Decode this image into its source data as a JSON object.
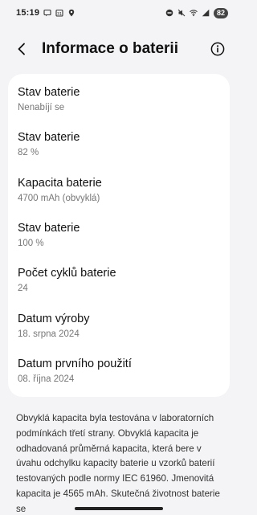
{
  "status_bar": {
    "time": "15:19",
    "battery": "82",
    "left_icons": [
      "message-icon",
      "calendar-icon",
      "location-icon"
    ],
    "right_icons": [
      "dnd-icon",
      "mute-icon",
      "wifi-icon",
      "signal-icon"
    ]
  },
  "header": {
    "title": "Informace o baterii"
  },
  "items": [
    {
      "label": "Stav baterie",
      "value": "Nenabíjí se"
    },
    {
      "label": "Stav baterie",
      "value": "82 %"
    },
    {
      "label": "Kapacita baterie",
      "value": "4700 mAh (obvyklá)"
    },
    {
      "label": "Stav baterie",
      "value": "100 %"
    },
    {
      "label": "Počet cyklů baterie",
      "value": "24"
    },
    {
      "label": "Datum výroby",
      "value": "18. srpna 2024"
    },
    {
      "label": "Datum prvního použití",
      "value": "08. října 2024"
    }
  ],
  "note": "Obvyklá kapacita byla testována v laboratorních podmínkách třetí strany. Obvyklá kapacita je odhadovaná průměrná kapacita, která bere v úvahu odchylku kapacity baterie u vzorků baterií testovaných podle normy IEC 61960. Jmenovitá kapacita je 4565 mAh. Skutečná životnost baterie se"
}
